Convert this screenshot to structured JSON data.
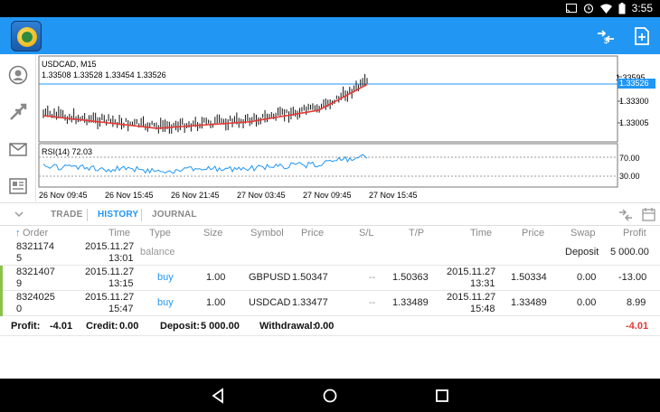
{
  "status": {
    "time": "3:55"
  },
  "chart": {
    "title": "USDCAD, M15",
    "ohlc": "1.33508 1.33528 1.33454 1.33526",
    "price_levels": [
      "1.33595",
      "1.33300",
      "1.33005"
    ],
    "current_price": "1.33526",
    "rsi_label": "RSI(14) 72.03",
    "rsi_levels": [
      "70.00",
      "30.00"
    ],
    "time_labels": [
      "26 Nov 09:45",
      "26 Nov 15:45",
      "26 Nov 21:45",
      "27 Nov 03:45",
      "27 Nov 09:45",
      "27 Nov 15:45"
    ],
    "colors": {
      "price": "#000000",
      "ma": "#e53935",
      "rsi": "#2196f3",
      "current_line": "#2196f3"
    }
  },
  "tabs": [
    "TRADE",
    "HISTORY",
    "JOURNAL"
  ],
  "active_tab": "HISTORY",
  "table": {
    "headers": {
      "order": "Order",
      "time": "Time",
      "type": "Type",
      "size": "Size",
      "symbol": "Symbol",
      "price": "Price",
      "sl": "S/L",
      "tp": "T/P",
      "time2": "Time",
      "price2": "Price",
      "swap": "Swap",
      "profit": "Profit"
    },
    "rows": [
      {
        "order1": "8321174",
        "order2": "5",
        "time1": "2015.11.27",
        "time2": "13:01",
        "type": "balance",
        "deposit_label": "Deposit",
        "profit": "5 000.00"
      },
      {
        "order1": "8321407",
        "order2": "9",
        "time1": "2015.11.27",
        "time2": "13:15",
        "type": "buy",
        "size": "1.00",
        "symbol": "GBPUSD",
        "price": "1.50347",
        "sl": "--",
        "tp": "1.50363",
        "close_time1": "2015.11.27",
        "close_time2": "13:31",
        "close_price": "1.50334",
        "swap": "0.00",
        "profit": "-13.00"
      },
      {
        "order1": "8324025",
        "order2": "0",
        "time1": "2015.11.27",
        "time2": "15:47",
        "type": "buy",
        "size": "1.00",
        "symbol": "USDCAD",
        "price": "1.33477",
        "sl": "--",
        "tp": "1.33489",
        "close_time1": "2015.11.27",
        "close_time2": "15:48",
        "close_price": "1.33489",
        "swap": "0.00",
        "profit": "8.99"
      }
    ]
  },
  "summary": {
    "profit_label": "Profit:",
    "profit_value": "-4.01",
    "credit_label": "Credit:",
    "credit_value": "0.00",
    "deposit_label": "Deposit:",
    "deposit_value": "5 000.00",
    "withdrawal_label": "Withdrawal:",
    "withdrawal_value": "0.00",
    "total": "-4.01"
  }
}
